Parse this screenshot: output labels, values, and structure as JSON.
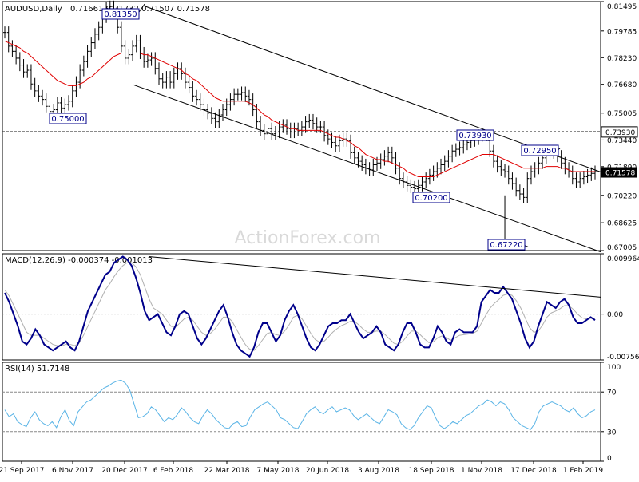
{
  "header": {
    "symbol": "AUDUSD,Daily",
    "ohlc": "0.71661 0.71732 0.71507 0.71578"
  },
  "watermark": "ActionForex.com",
  "colors": {
    "price_bars": "#000000",
    "sma": "#e00000",
    "macd_line": "#00008b",
    "macd_signal": "#b0b0b0",
    "rsi": "#5ab4e6",
    "channel": "#000000",
    "label_border": "#00008b",
    "grid_dashed": "#888888"
  },
  "chart_data": [
    {
      "type": "ohlc",
      "panel": "price",
      "ylim": [
        0.67005,
        0.81495
      ],
      "y_ticks": [
        "0.81495",
        "0.79785",
        "0.78230",
        "0.76680",
        "0.75005",
        "0.73440",
        "0.71890",
        "0.70220",
        "0.68625",
        "0.67005"
      ],
      "current_price": "0.71578",
      "current_value": 0.71578,
      "level_line": 0.7393,
      "level_line_label": "0.73930",
      "x_ticks": [
        "21 Sep 2017",
        "6 Nov 2017",
        "20 Dec 2017",
        "6 Feb 2018",
        "22 Mar 2018",
        "7 May 2018",
        "20 Jun 2018",
        "3 Aug 2018",
        "18 Sep 2018",
        "1 Nov 2018",
        "17 Dec 2018",
        "1 Feb 2019"
      ],
      "series": [
        {
          "kind": "close",
          "values": [
            0.797,
            0.789,
            0.786,
            0.782,
            0.778,
            0.774,
            0.775,
            0.767,
            0.763,
            0.76,
            0.758,
            0.754,
            0.751,
            0.752,
            0.756,
            0.753,
            0.755,
            0.757,
            0.763,
            0.768,
            0.775,
            0.78,
            0.786,
            0.791,
            0.796,
            0.8,
            0.806,
            0.811,
            0.812,
            0.809,
            0.8,
            0.789,
            0.782,
            0.784,
            0.789,
            0.792,
            0.785,
            0.78,
            0.781,
            0.782,
            0.776,
            0.77,
            0.768,
            0.771,
            0.768,
            0.773,
            0.776,
            0.773,
            0.768,
            0.765,
            0.76,
            0.758,
            0.755,
            0.752,
            0.75,
            0.747,
            0.745,
            0.749,
            0.752,
            0.755,
            0.758,
            0.761,
            0.761,
            0.762,
            0.76,
            0.758,
            0.752,
            0.745,
            0.74,
            0.738,
            0.741,
            0.738,
            0.739,
            0.742,
            0.743,
            0.741,
            0.739,
            0.741,
            0.74,
            0.742,
            0.745,
            0.746,
            0.744,
            0.742,
            0.742,
            0.737,
            0.735,
            0.733,
            0.731,
            0.734,
            0.735,
            0.734,
            0.727,
            0.724,
            0.722,
            0.72,
            0.718,
            0.717,
            0.72,
            0.721,
            0.723,
            0.725,
            0.727,
            0.724,
            0.718,
            0.712,
            0.71,
            0.708,
            0.707,
            0.706,
            0.708,
            0.71,
            0.712,
            0.714,
            0.716,
            0.718,
            0.72,
            0.722,
            0.725,
            0.728,
            0.729,
            0.73,
            0.732,
            0.733,
            0.734,
            0.735,
            0.737,
            0.738,
            0.734,
            0.728,
            0.722,
            0.719,
            0.717,
            0.716,
            0.712,
            0.709,
            0.705,
            0.703,
            0.701,
            0.712,
            0.716,
            0.718,
            0.721,
            0.724,
            0.726,
            0.727,
            0.728,
            0.725,
            0.721,
            0.718,
            0.716,
            0.712,
            0.71,
            0.712,
            0.713,
            0.714,
            0.715,
            0.716
          ]
        },
        {
          "kind": "sma",
          "values": [
            0.792,
            0.791,
            0.79,
            0.789,
            0.788,
            0.786,
            0.785,
            0.783,
            0.781,
            0.779,
            0.777,
            0.775,
            0.773,
            0.771,
            0.769,
            0.768,
            0.767,
            0.766,
            0.766,
            0.766,
            0.767,
            0.768,
            0.77,
            0.771,
            0.773,
            0.775,
            0.777,
            0.779,
            0.781,
            0.783,
            0.784,
            0.785,
            0.785,
            0.785,
            0.785,
            0.785,
            0.785,
            0.784,
            0.784,
            0.783,
            0.782,
            0.781,
            0.78,
            0.779,
            0.778,
            0.777,
            0.776,
            0.775,
            0.773,
            0.772,
            0.77,
            0.769,
            0.767,
            0.765,
            0.763,
            0.761,
            0.759,
            0.758,
            0.757,
            0.757,
            0.757,
            0.757,
            0.757,
            0.757,
            0.757,
            0.756,
            0.755,
            0.753,
            0.751,
            0.749,
            0.748,
            0.746,
            0.745,
            0.744,
            0.743,
            0.742,
            0.741,
            0.741,
            0.74,
            0.74,
            0.74,
            0.74,
            0.74,
            0.74,
            0.74,
            0.739,
            0.738,
            0.737,
            0.736,
            0.736,
            0.735,
            0.734,
            0.733,
            0.731,
            0.73,
            0.728,
            0.726,
            0.725,
            0.724,
            0.723,
            0.723,
            0.722,
            0.722,
            0.721,
            0.72,
            0.719,
            0.718,
            0.716,
            0.715,
            0.714,
            0.713,
            0.713,
            0.713,
            0.713,
            0.713,
            0.714,
            0.715,
            0.716,
            0.717,
            0.718,
            0.719,
            0.72,
            0.721,
            0.722,
            0.723,
            0.724,
            0.725,
            0.726,
            0.726,
            0.726,
            0.726,
            0.725,
            0.724,
            0.723,
            0.722,
            0.721,
            0.72,
            0.719,
            0.718,
            0.718,
            0.718,
            0.718,
            0.718,
            0.718,
            0.719,
            0.719,
            0.719,
            0.719,
            0.718,
            0.718,
            0.717,
            0.716,
            0.716,
            0.716,
            0.716,
            0.716,
            0.716,
            0.716
          ]
        }
      ],
      "channel_upper": [
        [
          0.8125,
          0.7112
        ],
        11
      ],
      "annotations": [
        {
          "label": "0.81350",
          "value": 0.8135
        },
        {
          "label": "0.75000",
          "value": 0.75
        },
        {
          "label": "0.73930",
          "value": 0.7393
        },
        {
          "label": "0.72950",
          "value": 0.7295
        },
        {
          "label": "0.70200",
          "value": 0.702
        },
        {
          "label": "0.67220",
          "value": 0.6722
        }
      ]
    },
    {
      "type": "line",
      "panel": "macd",
      "title": "MACD(12,26,9) -0.000374 -0.001013",
      "ylim": [
        -0.00756,
        0.009964
      ],
      "y_ticks": [
        "0.009964",
        "0.00",
        "-0.00756"
      ],
      "series": [
        {
          "name": "MACD",
          "values": [
            0.0035,
            0.002,
            0.0,
            -0.002,
            -0.0045,
            -0.005,
            -0.004,
            -0.0025,
            -0.0035,
            -0.005,
            -0.0055,
            -0.006,
            -0.0055,
            -0.005,
            -0.0045,
            -0.0055,
            -0.006,
            -0.0045,
            -0.002,
            0.0005,
            0.002,
            0.0035,
            0.005,
            0.0065,
            0.007,
            0.0085,
            0.009,
            0.0095,
            0.009,
            0.008,
            0.006,
            0.0035,
            0.0005,
            -0.001,
            -0.0005,
            0.0,
            -0.0015,
            -0.003,
            -0.0035,
            -0.002,
            0.0,
            0.0005,
            0.0,
            -0.002,
            -0.004,
            -0.005,
            -0.004,
            -0.0025,
            -0.001,
            0.0005,
            0.0015,
            -0.0005,
            -0.003,
            -0.005,
            -0.006,
            -0.0065,
            -0.007,
            -0.0055,
            -0.003,
            -0.0015,
            -0.0015,
            -0.003,
            -0.0045,
            -0.0035,
            -0.001,
            0.0005,
            0.0015,
            0.0,
            -0.002,
            -0.004,
            -0.0055,
            -0.006,
            -0.005,
            -0.0035,
            -0.002,
            -0.0015,
            -0.0015,
            -0.001,
            -0.001,
            0.0,
            -0.0015,
            -0.003,
            -0.004,
            -0.0035,
            -0.003,
            -0.002,
            -0.003,
            -0.005,
            -0.0055,
            -0.006,
            -0.005,
            -0.003,
            -0.0015,
            -0.0015,
            -0.003,
            -0.005,
            -0.0055,
            -0.0055,
            -0.004,
            -0.002,
            -0.003,
            -0.0045,
            -0.005,
            -0.003,
            -0.0025,
            -0.003,
            -0.003,
            -0.003,
            -0.002,
            0.002,
            0.003,
            0.004,
            0.0035,
            0.0035,
            0.0045,
            0.0035,
            0.0025,
            0.0005,
            -0.0015,
            -0.004,
            -0.0055,
            -0.0045,
            -0.002,
            0.0,
            0.002,
            0.0015,
            0.001,
            0.002,
            0.0025,
            0.0015,
            -0.0005,
            -0.0015,
            -0.0015,
            -0.001,
            -0.0005,
            -0.001
          ]
        },
        {
          "name": "Signal",
          "values": [
            0.004,
            0.003,
            0.0015,
            0.0,
            -0.0015,
            -0.003,
            -0.0035,
            -0.0035,
            -0.0035,
            -0.004,
            -0.0045,
            -0.005,
            -0.0052,
            -0.0052,
            -0.005,
            -0.005,
            -0.0052,
            -0.0048,
            -0.0035,
            -0.002,
            -0.0005,
            0.001,
            0.0025,
            0.004,
            0.005,
            0.0062,
            0.0072,
            0.008,
            0.0085,
            0.0085,
            0.0078,
            0.0065,
            0.0045,
            0.0025,
            0.001,
            0.0005,
            0.0,
            -0.001,
            -0.002,
            -0.0022,
            -0.0015,
            -0.0008,
            -0.0005,
            -0.001,
            -0.002,
            -0.003,
            -0.0035,
            -0.0032,
            -0.0025,
            -0.0015,
            -0.0005,
            -0.0005,
            -0.0012,
            -0.0025,
            -0.0038,
            -0.005,
            -0.0058,
            -0.006,
            -0.0052,
            -0.0042,
            -0.0032,
            -0.003,
            -0.0034,
            -0.0035,
            -0.0028,
            -0.0018,
            -0.0005,
            -0.0002,
            -0.0008,
            -0.002,
            -0.0032,
            -0.0042,
            -0.0046,
            -0.0045,
            -0.0038,
            -0.003,
            -0.0024,
            -0.0019,
            -0.0016,
            -0.0012,
            -0.0012,
            -0.0018,
            -0.0025,
            -0.003,
            -0.003,
            -0.0028,
            -0.0028,
            -0.0034,
            -0.0041,
            -0.0048,
            -0.005,
            -0.0045,
            -0.0036,
            -0.0028,
            -0.0028,
            -0.0034,
            -0.0041,
            -0.0047,
            -0.0046,
            -0.0039,
            -0.0036,
            -0.0039,
            -0.0043,
            -0.0039,
            -0.0035,
            -0.0034,
            -0.0033,
            -0.0032,
            -0.0028,
            -0.0015,
            -0.0002,
            0.001,
            0.0018,
            0.0024,
            0.0031,
            0.0033,
            0.0031,
            0.0022,
            0.001,
            -0.0006,
            -0.0022,
            -0.003,
            -0.0028,
            -0.0018,
            -0.0005,
            0.0002,
            0.0005,
            0.0009,
            0.0014,
            0.0014,
            0.0008,
            0.0,
            -0.0006,
            -0.0008,
            -0.0007,
            -0.0008
          ]
        }
      ]
    },
    {
      "type": "line",
      "panel": "rsi",
      "title": "RSI(14) 51.7148",
      "ylim": [
        0,
        100
      ],
      "y_ticks": [
        "100",
        "70",
        "30",
        "0"
      ],
      "levels": [
        70,
        30
      ],
      "series": [
        {
          "name": "RSI",
          "values": [
            52,
            45,
            48,
            40,
            37,
            35,
            44,
            50,
            42,
            38,
            36,
            40,
            34,
            45,
            52,
            41,
            36,
            50,
            55,
            60,
            62,
            66,
            70,
            74,
            76,
            79,
            81,
            82,
            79,
            72,
            58,
            44,
            45,
            48,
            55,
            52,
            46,
            40,
            44,
            42,
            47,
            54,
            50,
            44,
            40,
            38,
            46,
            52,
            48,
            42,
            38,
            34,
            33,
            38,
            40,
            35,
            36,
            45,
            52,
            55,
            58,
            60,
            56,
            52,
            44,
            42,
            38,
            34,
            33,
            40,
            48,
            52,
            55,
            50,
            48,
            52,
            55,
            50,
            52,
            54,
            52,
            46,
            42,
            45,
            48,
            44,
            40,
            38,
            45,
            52,
            50,
            47,
            38,
            34,
            32,
            36,
            44,
            50,
            56,
            54,
            44,
            36,
            33,
            36,
            40,
            38,
            42,
            46,
            48,
            52,
            56,
            58,
            62,
            60,
            56,
            60,
            58,
            52,
            44,
            40,
            36,
            34,
            32,
            38,
            50,
            56,
            58,
            60,
            58,
            56,
            52,
            50,
            54,
            48,
            44,
            46,
            50,
            52
          ]
        }
      ]
    }
  ]
}
